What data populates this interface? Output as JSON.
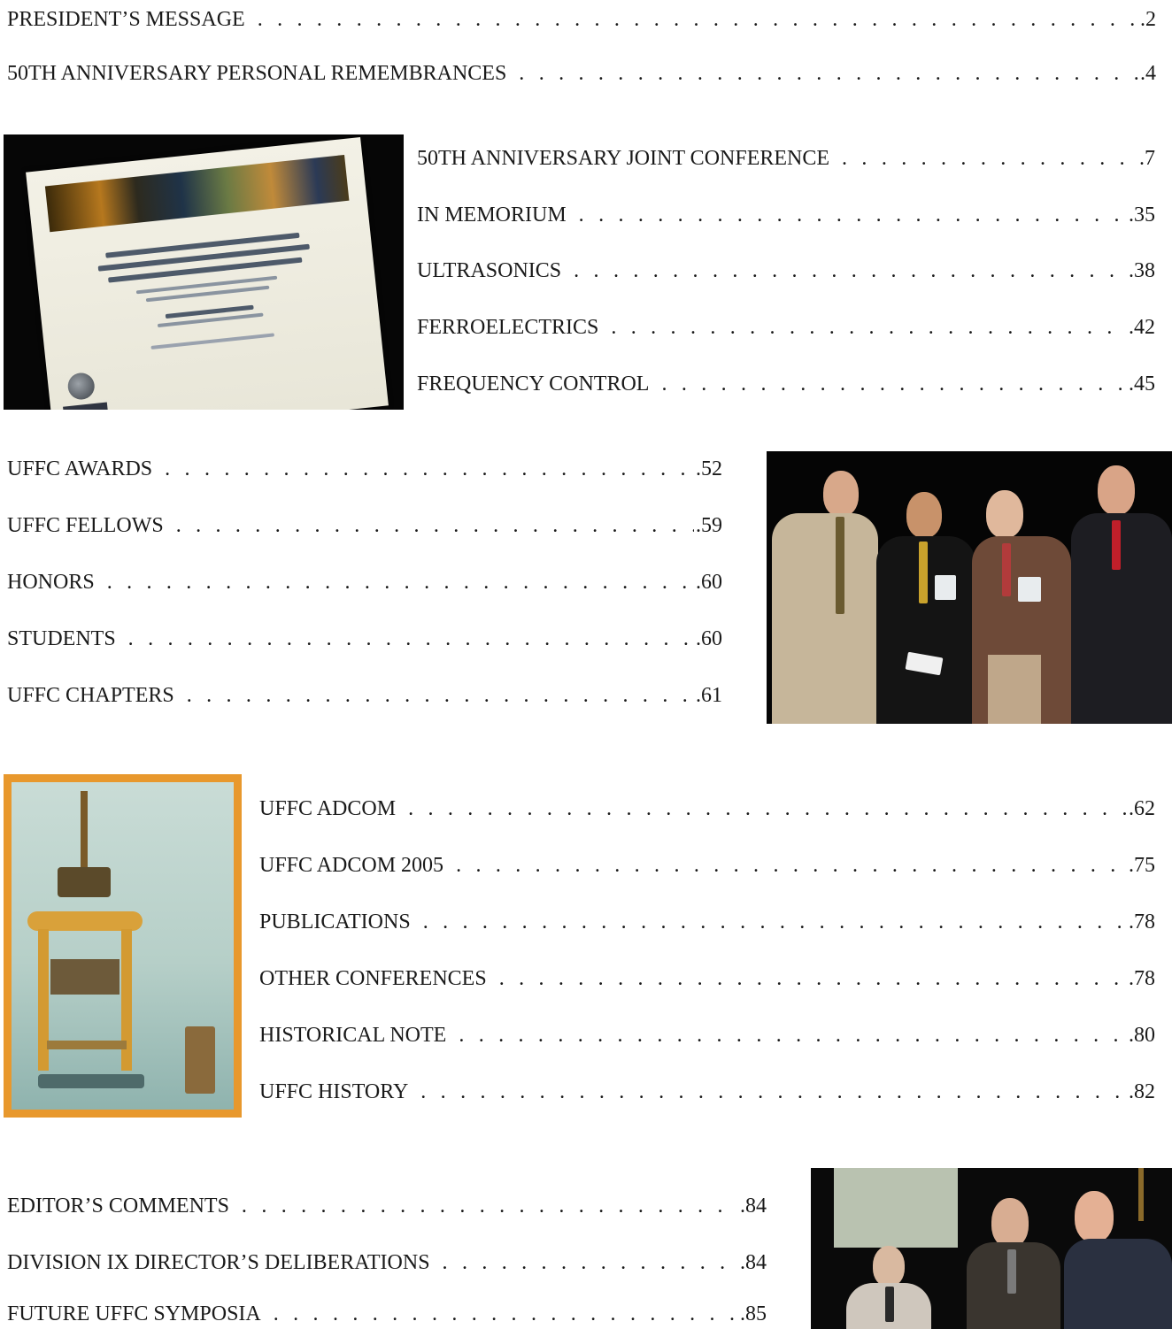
{
  "toc": [
    {
      "title": "PRESIDENT’S MESSAGE",
      "page": ".2"
    },
    {
      "title": "50TH ANNIVERSARY PERSONAL REMEMBRANCES",
      "page": ".4"
    },
    {
      "title": "50TH ANNIVERSARY JOINT CONFERENCE",
      "page": ".7"
    },
    {
      "title": "IN MEMORIUM",
      "page": ".35"
    },
    {
      "title": "ULTRASONICS",
      "page": ".38"
    },
    {
      "title": "FERROELECTRICS",
      "page": ".42"
    },
    {
      "title": "FREQUENCY CONTROL",
      "page": ".45"
    },
    {
      "title": "UFFC AWARDS",
      "page": ".52"
    },
    {
      "title": "UFFC FELLOWS",
      "page": ".59"
    },
    {
      "title": "HONORS",
      "page": ".60"
    },
    {
      "title": "STUDENTS",
      "page": ".60"
    },
    {
      "title": "UFFC CHAPTERS",
      "page": ".61"
    },
    {
      "title": "UFFC ADCOM",
      "page": ".62"
    },
    {
      "title": "UFFC ADCOM 2005",
      "page": ".75"
    },
    {
      "title": "PUBLICATIONS",
      "page": ".78"
    },
    {
      "title": "OTHER CONFERENCES",
      "page": ".78"
    },
    {
      "title": "HISTORICAL NOTE",
      "page": ".80"
    },
    {
      "title": "UFFC HISTORY",
      "page": ".82"
    },
    {
      "title": "EDITOR’S COMMENTS",
      "page": ".84"
    },
    {
      "title": "DIVISION IX DIRECTOR’S DELIBERATIONS",
      "page": ".84"
    },
    {
      "title": "FUTURE UFFC SYMPOSIA",
      "page": ".85"
    }
  ],
  "leader_dots": ". . . . . . . . . . . . . . . . . . . . . . . . . . . . . . . . . . . . . . . . . . . . . . . . . . . . . . . . . . . . . . . . . . . . . . . . . . . . . . . . . . . . . . . . . . . . . . . .",
  "colors": {
    "text": "#1a1a1a",
    "background": "#ffffff",
    "photo_frame_orange": "#e8982d"
  }
}
